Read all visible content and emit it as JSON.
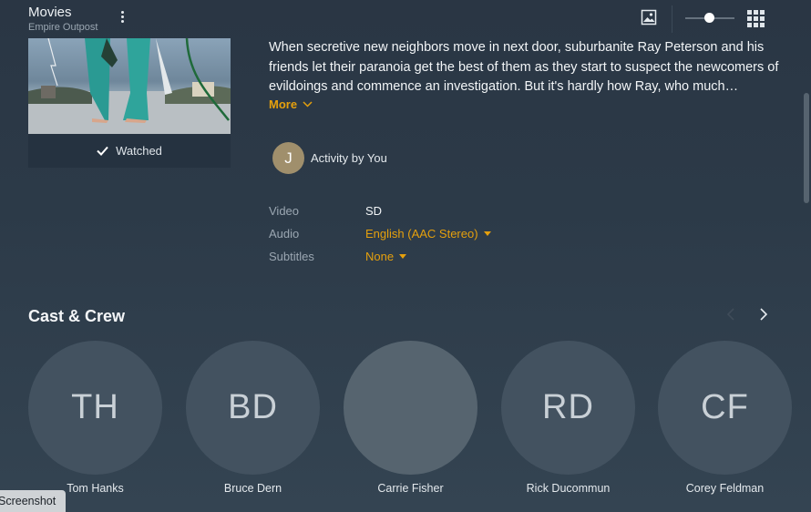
{
  "header": {
    "section_title": "Movies",
    "server_name": "Empire Outpost"
  },
  "poster": {
    "watched_label": "Watched"
  },
  "summary": {
    "text": "When secretive new neighbors move in next door, suburbanite Ray Peterson and his friends let their paranoia get the best of them as they start to suspect the newcomers of evildoings and commence an investigation. But it's hardly how Ray, who much…",
    "more_label": "More"
  },
  "activity": {
    "avatar_initial": "J",
    "label": "Activity by You"
  },
  "media_info": {
    "video_label": "Video",
    "video_value": "SD",
    "audio_label": "Audio",
    "audio_value": "English (AAC Stereo)",
    "subtitles_label": "Subtitles",
    "subtitles_value": "None"
  },
  "cast": {
    "title": "Cast & Crew",
    "people": [
      {
        "initials": "TH",
        "name": "Tom Hanks"
      },
      {
        "initials": "BD",
        "name": "Bruce Dern"
      },
      {
        "initials": "",
        "name": "Carrie Fisher"
      },
      {
        "initials": "RD",
        "name": "Rick Ducommun"
      },
      {
        "initials": "CF",
        "name": "Corey Feldman"
      }
    ]
  },
  "tooltip": {
    "text": "Screenshot"
  },
  "colors": {
    "accent": "#e5a00d",
    "background": "#2c3a48",
    "avatar": "#a08f6c"
  },
  "icons": {
    "more_menu": "kebab-icon",
    "photo": "photo-icon",
    "grid": "grid-icon",
    "watched": "check-icon",
    "more_expand": "chevron-down-icon",
    "prev": "chevron-left-icon",
    "next": "chevron-right-icon"
  }
}
